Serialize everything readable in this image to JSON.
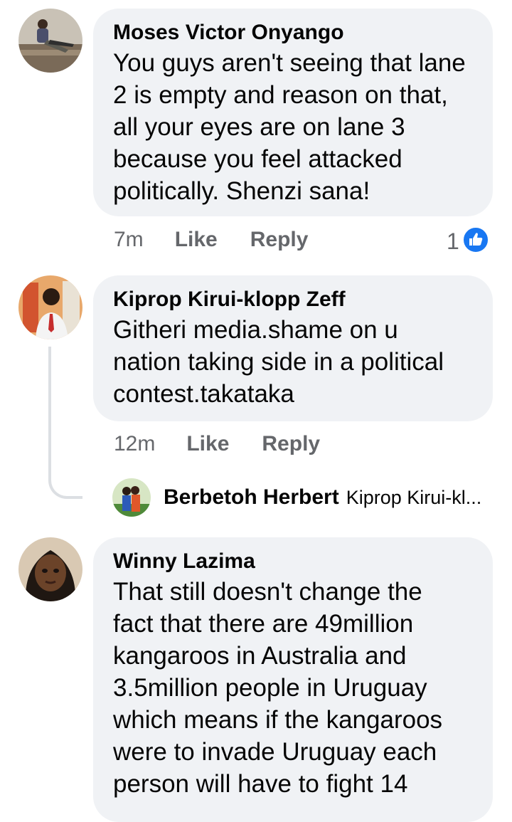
{
  "comments": [
    {
      "author": "Moses Victor Onyango",
      "lines": [
        "You guys aren't seeing that lane",
        "2 is empty and reason on that,",
        "all your eyes are on lane 3",
        "because you feel attacked",
        "politically. Shenzi sana!"
      ],
      "time": "7m",
      "like_label": "Like",
      "reply_label": "Reply",
      "reaction_count": "1"
    },
    {
      "author": "Kiprop Kirui-klopp Zeff",
      "lines": [
        "Githeri media.shame on u",
        "nation taking side in a political",
        "contest.takataka"
      ],
      "time": "12m",
      "like_label": "Like",
      "reply_label": "Reply"
    },
    {
      "author": "Winny Lazima",
      "lines": [
        "That still doesn't change the",
        "fact that there are 49million",
        "kangaroos in Australia and",
        "3.5million people in Uruguay",
        "which means if the kangaroos",
        "were to invade Uruguay each",
        "person will have to fight 14"
      ]
    }
  ],
  "reply_preview": {
    "author": "Berbetoh Herbert",
    "snippet": "Kiprop Kirui-kl..."
  },
  "colors": {
    "bubble": "#f0f2f5",
    "meta_text": "#65676b",
    "like_blue": "#1877f2",
    "thread_line": "#dcdfe3"
  }
}
